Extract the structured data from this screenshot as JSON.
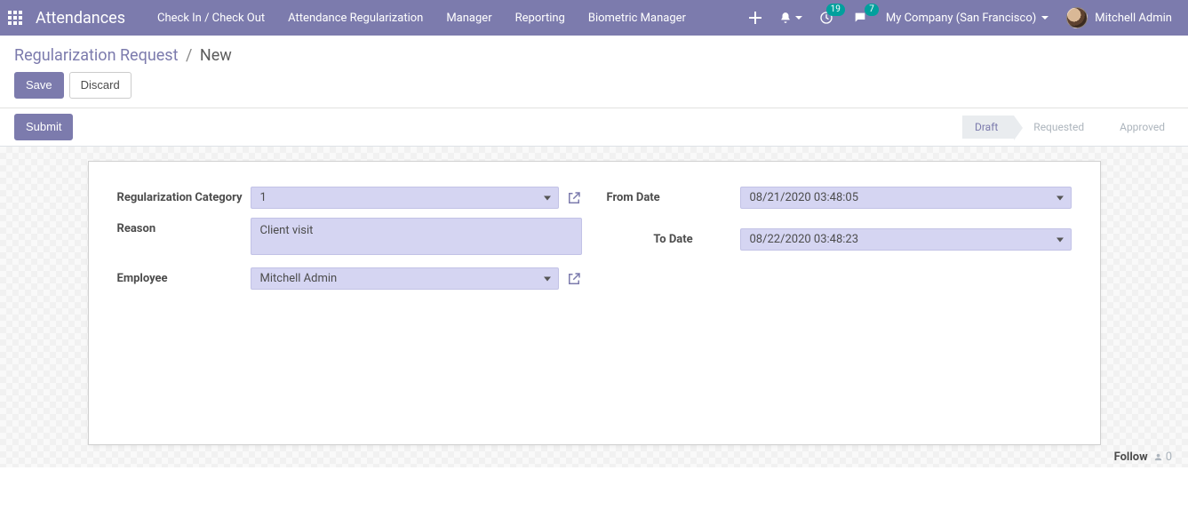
{
  "navbar": {
    "brand": "Attendances",
    "menu": [
      "Check In / Check Out",
      "Attendance Regularization",
      "Manager",
      "Reporting",
      "Biometric Manager"
    ],
    "clock_badge": "19",
    "chat_badge": "7",
    "company": "My Company (San Francisco)",
    "user": "Mitchell Admin"
  },
  "breadcrumb": {
    "parent": "Regularization Request",
    "current": "New"
  },
  "buttons": {
    "save": "Save",
    "discard": "Discard",
    "submit": "Submit"
  },
  "status": {
    "draft": "Draft",
    "requested": "Requested",
    "approved": "Approved"
  },
  "form": {
    "labels": {
      "category": "Regularization Category",
      "reason": "Reason",
      "employee": "Employee",
      "from_date": "From Date",
      "to_date": "To Date"
    },
    "values": {
      "category": "1",
      "reason": "Client visit",
      "employee": "Mitchell Admin",
      "from_date": "08/21/2020 03:48:05",
      "to_date": "08/22/2020 03:48:23"
    }
  },
  "footer": {
    "follow": "Follow",
    "follower_count": "0"
  }
}
